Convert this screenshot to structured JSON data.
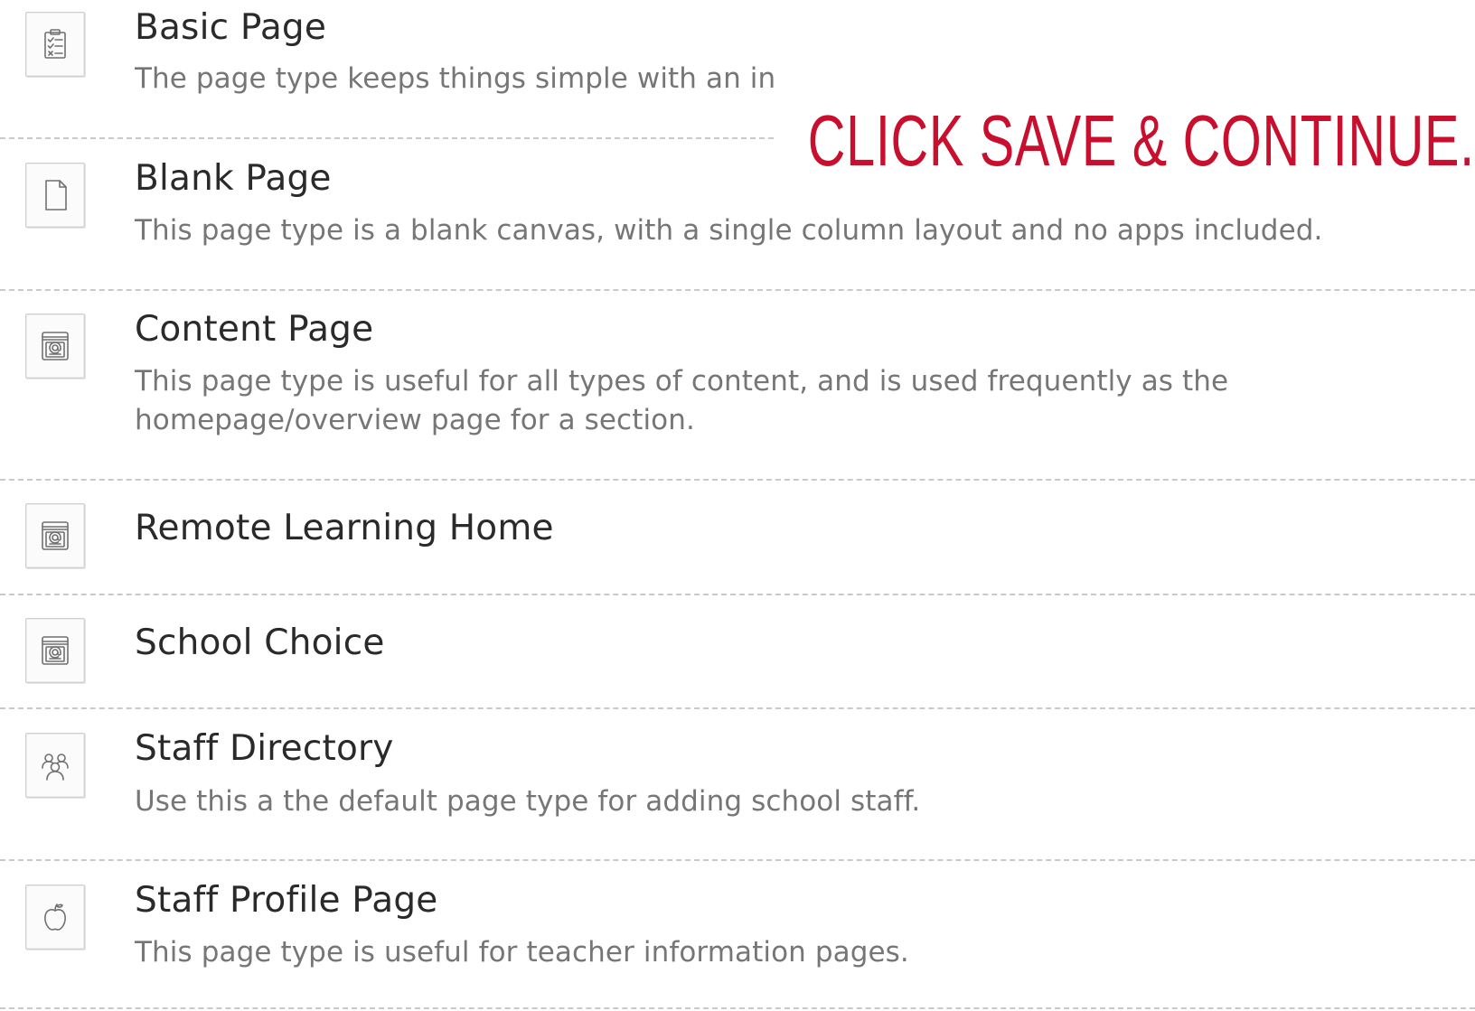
{
  "callout": {
    "text": "CLICK SAVE & CONTINUE.",
    "color": "#c8102e"
  },
  "page_types": [
    {
      "title": "Basic Page",
      "description": "The page type keeps things simple with an in",
      "icon": "clipboard-checklist-icon"
    },
    {
      "title": "Blank Page",
      "description": "This page type is a blank canvas, with a single column layout and no apps included.",
      "icon": "blank-document-icon"
    },
    {
      "title": "Content Page",
      "description": "This page type is useful for all types of content, and is used frequently as the homepage/overview page for a section.",
      "icon": "content-book-icon"
    },
    {
      "title": "Remote Learning Home",
      "description": "",
      "icon": "content-book-icon"
    },
    {
      "title": "School Choice",
      "description": "",
      "icon": "content-book-icon"
    },
    {
      "title": "Staff Directory",
      "description": "Use this a the default page type for adding school staff.",
      "icon": "people-group-icon"
    },
    {
      "title": "Staff Profile Page",
      "description": "This page type is useful for teacher information pages.",
      "icon": "apple-icon"
    }
  ]
}
